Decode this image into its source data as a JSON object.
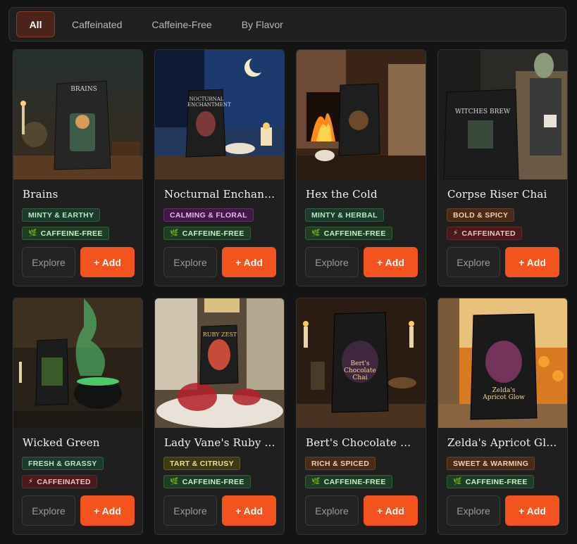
{
  "tabs": [
    {
      "label": "All",
      "active": true
    },
    {
      "label": "Caffeinated",
      "active": false
    },
    {
      "label": "Caffeine-Free",
      "active": false
    },
    {
      "label": "By Flavor",
      "active": false
    }
  ],
  "labels": {
    "explore": "Explore",
    "add": "+ Add"
  },
  "products": [
    {
      "name": "Brains",
      "flavor": "MINTY & EARTHY",
      "flavor_style": "green",
      "caffeine": "CAFFEINE-FREE",
      "caff_style": "free",
      "bag_text": "BRAINS"
    },
    {
      "name": "Nocturnal Enchantment",
      "flavor": "CALMING & FLORAL",
      "flavor_style": "purple",
      "caffeine": "CAFFEINE-FREE",
      "caff_style": "free",
      "bag_text": "NOCTURNAL ENCHANTMENT"
    },
    {
      "name": "Hex the Cold",
      "flavor": "MINTY & HERBAL",
      "flavor_style": "green",
      "caffeine": "CAFFEINE-FREE",
      "caff_style": "free",
      "bag_text": ""
    },
    {
      "name": "Corpse Riser Chai",
      "flavor": "BOLD & SPICY",
      "flavor_style": "brown",
      "caffeine": "CAFFEINATED",
      "caff_style": "caf",
      "bag_text": "WITCHES BREW"
    },
    {
      "name": "Wicked Green",
      "flavor": "FRESH & GRASSY",
      "flavor_style": "green",
      "caffeine": "CAFFEINATED",
      "caff_style": "caf",
      "bag_text": ""
    },
    {
      "name": "Lady Vane's Ruby Zest",
      "flavor": "TART & CITRUSY",
      "flavor_style": "olive",
      "caffeine": "CAFFEINE-FREE",
      "caff_style": "free",
      "bag_text": "RUBY ZEST"
    },
    {
      "name": "Bert's Chocolate Chai",
      "flavor": "RICH & SPICED",
      "flavor_style": "brown",
      "caffeine": "CAFFEINE-FREE",
      "caff_style": "free",
      "bag_text": "Bert's Chocolate Chai"
    },
    {
      "name": "Zelda's Apricot Glow",
      "flavor": "SWEET & WARMING",
      "flavor_style": "brown",
      "caffeine": "CAFFEINE-FREE",
      "caff_style": "free",
      "bag_text": "Zelda's Apricot Glow"
    }
  ],
  "icons": {
    "caffeine_free": "leaf-icon",
    "caffeinated": "lightning-icon"
  },
  "colors": {
    "accent": "#f5531e",
    "background": "#141414",
    "card": "#1f1f1f"
  }
}
